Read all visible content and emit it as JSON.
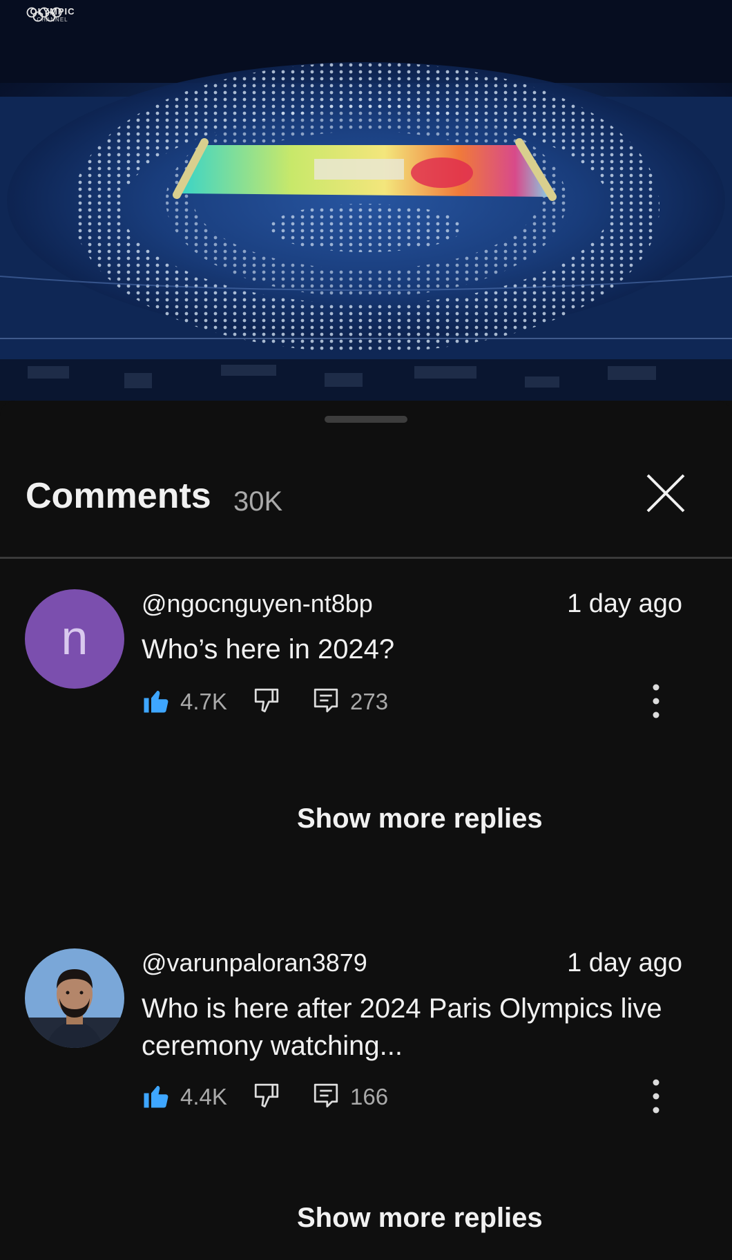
{
  "video": {
    "logo_word1": "OLYMPIC",
    "logo_word2": "CHANNEL"
  },
  "comments_panel": {
    "title": "Comments",
    "count": "30K",
    "close_icon": "close-icon"
  },
  "comments": [
    {
      "avatar_letter": "n",
      "avatar_color": "#7b4fae",
      "author": "@ngocnguyen-nt8bp",
      "time": "1 day ago",
      "text": "Who’s here in 2024?",
      "likes": "4.7K",
      "replies": "273",
      "show_more": "Show more replies"
    },
    {
      "avatar_letter": "",
      "author": "@varunpaloran3879",
      "time": "1 day ago",
      "text": "Who is here after 2024 Paris Olympics live ceremony watching...",
      "likes": "4.4K",
      "replies": "166",
      "show_more": "Show more replies"
    }
  ],
  "colors": {
    "like_active": "#3ea6ff",
    "background": "#0f0f0f",
    "secondary_text": "#aaaaaa"
  }
}
